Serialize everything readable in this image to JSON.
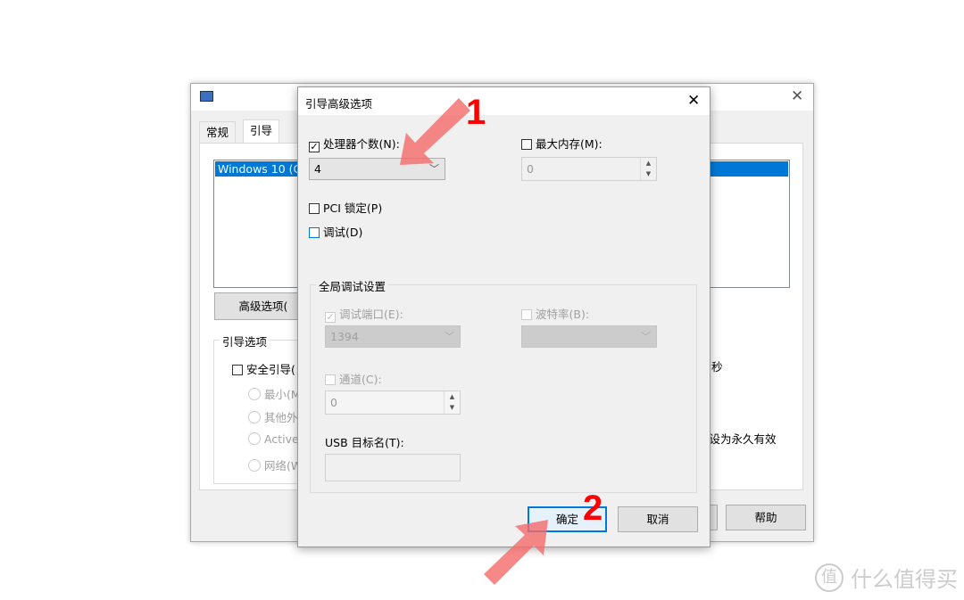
{
  "bg_window": {
    "tabs": [
      "常规",
      "引导"
    ],
    "os_entry": "Windows 10 (C",
    "advanced_button": "高级选项(",
    "boot_options_group": "引导选项",
    "safe_boot": "安全引导(",
    "radios": [
      "最小(M",
      "其他外",
      "Active",
      "网络(W"
    ],
    "seconds_fragment": "秒",
    "permanent_fragment": "置设为永久有效",
    "help_button": "帮助"
  },
  "dialog": {
    "title": "引导高级选项",
    "num_processors_label": "处理器个数(N):",
    "num_processors_checked": true,
    "num_processors_value": "4",
    "max_memory_label": "最大内存(M):",
    "max_memory_checked": false,
    "max_memory_value": "0",
    "pci_lock_label": "PCI 锁定(P)",
    "debug_label": "调试(D)",
    "global_debug_group": "全局调试设置",
    "debug_port_label": "调试端口(E):",
    "debug_port_value": "1394",
    "baud_rate_label": "波特率(B):",
    "channel_label": "通道(C):",
    "channel_value": "0",
    "usb_target_label": "USB 目标名(T):",
    "ok_button": "确定",
    "cancel_button": "取消"
  },
  "annotations": {
    "step1": "1",
    "step2": "2",
    "arrow_color": "#f46a6a"
  },
  "watermark": {
    "logo_char": "值",
    "text": "什么值得买"
  }
}
